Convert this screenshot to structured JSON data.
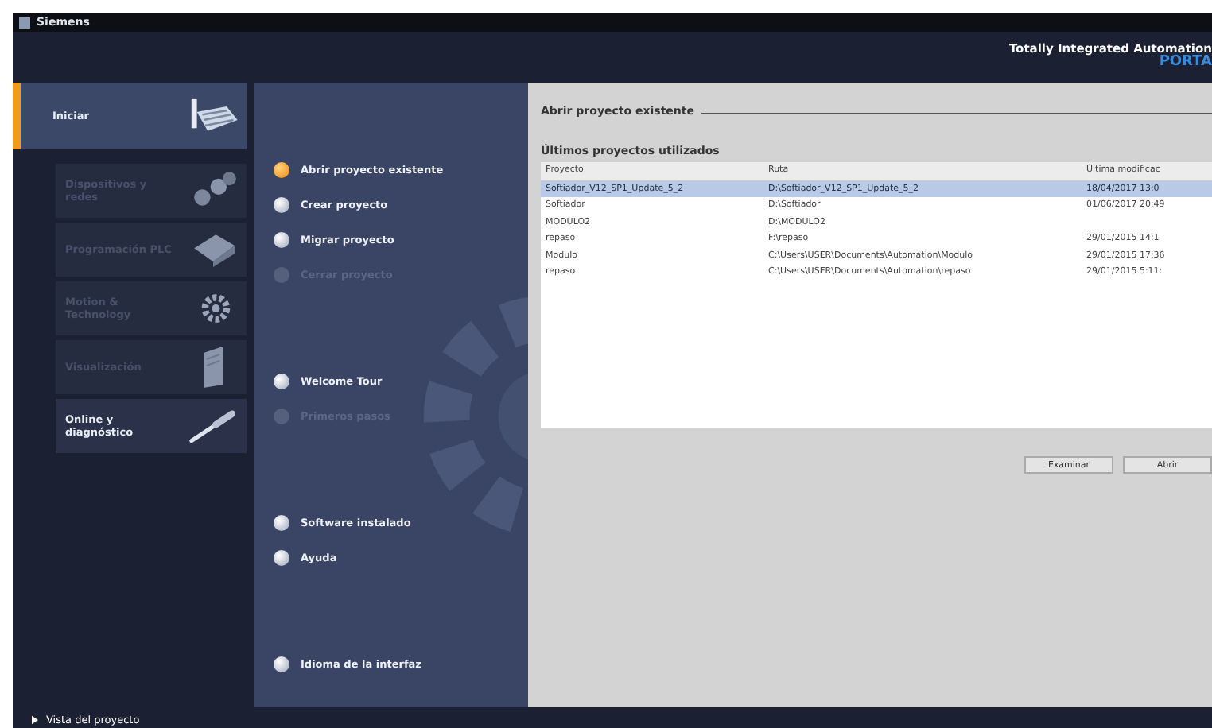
{
  "window": {
    "title": "Siemens"
  },
  "brand": {
    "line1": "Totally Integrated Automation",
    "line2": "PORTA"
  },
  "sidebar": {
    "items": [
      {
        "label": "Iniciar",
        "kind": "start",
        "selected": true,
        "disabled": false
      },
      {
        "label": "Dispositivos y redes",
        "kind": "devices",
        "selected": false,
        "disabled": true
      },
      {
        "label": "Programación PLC",
        "kind": "plc",
        "selected": false,
        "disabled": true
      },
      {
        "label": "Motion & Technology",
        "kind": "motion",
        "selected": false,
        "disabled": true
      },
      {
        "label": "Visualización",
        "kind": "hmi",
        "selected": false,
        "disabled": true
      },
      {
        "label": "Online y diagnóstico",
        "kind": "online",
        "selected": false,
        "disabled": false
      }
    ],
    "footer": "Vista del proyecto"
  },
  "menu_groups": [
    [
      {
        "label": "Abrir proyecto existente",
        "selected": true,
        "disabled": false
      },
      {
        "label": "Crear proyecto",
        "selected": false,
        "disabled": false
      },
      {
        "label": "Migrar proyecto",
        "selected": false,
        "disabled": false
      },
      {
        "label": "Cerrar proyecto",
        "selected": false,
        "disabled": true
      }
    ],
    [
      {
        "label": "Welcome Tour",
        "selected": false,
        "disabled": false
      },
      {
        "label": "Primeros pasos",
        "selected": false,
        "disabled": true
      }
    ],
    [
      {
        "label": "Software instalado",
        "selected": false,
        "disabled": false
      },
      {
        "label": "Ayuda",
        "selected": false,
        "disabled": false
      }
    ],
    [
      {
        "label": "Idioma de la interfaz",
        "selected": false,
        "disabled": false
      }
    ]
  ],
  "content": {
    "title": "Abrir proyecto existente",
    "subtitle": "Últimos proyectos utilizados",
    "table": {
      "columns": [
        "Proyecto",
        "Ruta",
        "Última modificac"
      ],
      "rows": [
        {
          "cells": [
            "Softiador_V12_SP1_Update_5_2",
            "D:\\Softiador_V12_SP1_Update_5_2",
            "18/04/2017 13:0"
          ],
          "selected": true
        },
        {
          "cells": [
            "Softiador",
            "D:\\Softiador",
            "01/06/2017 20:49"
          ],
          "selected": false
        },
        {
          "cells": [
            "MODULO2",
            "D:\\MODULO2",
            ""
          ],
          "selected": false
        },
        {
          "cells": [
            "repaso",
            "F:\\repaso",
            "29/01/2015 14:1"
          ],
          "selected": false
        },
        {
          "cells": [
            "Modulo",
            "C:\\Users\\USER\\Documents\\Automation\\Modulo",
            "29/01/2015 17:36"
          ],
          "selected": false
        },
        {
          "cells": [
            "repaso",
            "C:\\Users\\USER\\Documents\\Automation\\repaso",
            "29/01/2015 5:11:"
          ],
          "selected": false
        }
      ]
    },
    "buttons": [
      "Examinar",
      "Abrir"
    ]
  }
}
